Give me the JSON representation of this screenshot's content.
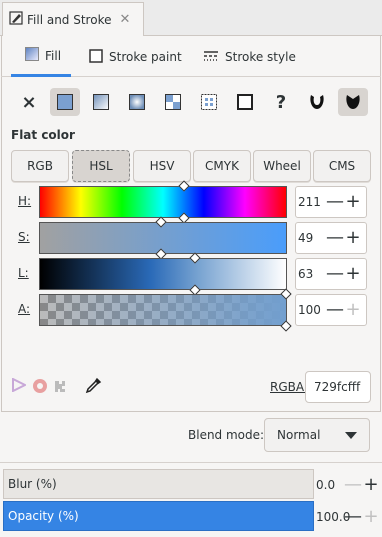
{
  "dock_tab": {
    "title": "Fill and Stroke",
    "close_glyph": "✕"
  },
  "tabs": {
    "fill": "Fill",
    "stroke_paint": "Stroke paint",
    "stroke_style": "Stroke style"
  },
  "paint_types": [
    {
      "name": "no-paint-icon",
      "glyph": "×"
    },
    {
      "name": "flat-color-icon",
      "glyph": "",
      "selected": true
    },
    {
      "name": "linear-gradient-icon",
      "glyph": ""
    },
    {
      "name": "radial-gradient-icon",
      "glyph": ""
    },
    {
      "name": "pattern-icon",
      "glyph": ""
    },
    {
      "name": "swatch-icon",
      "glyph": ""
    },
    {
      "name": "mesh-gradient-icon",
      "glyph": ""
    },
    {
      "name": "unset-paint-icon",
      "glyph": "?"
    },
    {
      "name": "fill-rule-evenodd-icon",
      "glyph": ""
    },
    {
      "name": "fill-rule-nonzero-icon",
      "glyph": ""
    }
  ],
  "flat_color_label": "Flat color",
  "modes": [
    "RGB",
    "HSL",
    "HSV",
    "CMYK",
    "Wheel",
    "CMS"
  ],
  "selected_mode": "HSL",
  "sliders": {
    "h": {
      "label": "H:",
      "value": "211",
      "fraction": 0.586
    },
    "s": {
      "label": "S:",
      "value": "49",
      "fraction": 0.49
    },
    "l": {
      "label": "L:",
      "value": "63",
      "fraction": 0.63
    },
    "a": {
      "label": "A:",
      "value": "100",
      "fraction": 1.0
    }
  },
  "rgba": {
    "label": "RGBA:",
    "value": "729fcfff"
  },
  "blend": {
    "label": "Blend mode:",
    "value": "Normal"
  },
  "blur": {
    "label": "Blur (%)",
    "value": "0.0"
  },
  "opacity": {
    "label": "Opacity (%)",
    "value": "100.0"
  },
  "colors": {
    "accent": "#3584e4",
    "current": "#729fcf"
  },
  "bottom_icons": [
    "color-managed-icon",
    "out-of-gamut-icon",
    "too-much-ink-icon",
    "color-picker-icon"
  ]
}
